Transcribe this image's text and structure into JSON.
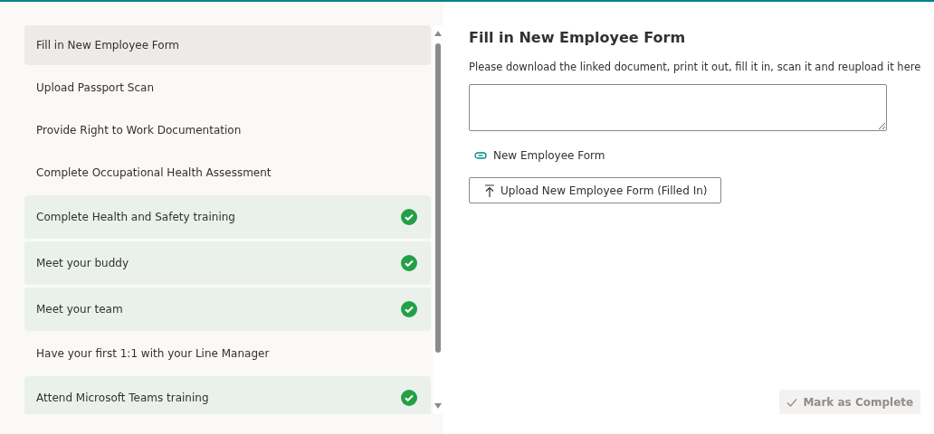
{
  "tasks": [
    {
      "title": "Fill in New Employee Form",
      "selected": true,
      "completed": false
    },
    {
      "title": "Upload Passport Scan",
      "selected": false,
      "completed": false
    },
    {
      "title": "Provide Right to Work Documentation",
      "selected": false,
      "completed": false
    },
    {
      "title": "Complete Occupational Health Assessment",
      "selected": false,
      "completed": false
    },
    {
      "title": "Complete Health and Safety training",
      "selected": false,
      "completed": true
    },
    {
      "title": "Meet your buddy",
      "selected": false,
      "completed": true
    },
    {
      "title": "Meet your team",
      "selected": false,
      "completed": true
    },
    {
      "title": "Have your first 1:1 with your Line Manager",
      "selected": false,
      "completed": false
    },
    {
      "title": "Attend Microsoft Teams training",
      "selected": false,
      "completed": true
    }
  ],
  "detail": {
    "title": "Fill in New Employee Form",
    "description": "Please download the linked document, print it out, fill it in, scan it and reupload it here",
    "link": "New Employee Form",
    "upload_button": "Upload New Employee Form (Filled In)",
    "complete_button": {
      "label": "Mark as Complete",
      "disabled": true
    }
  }
}
